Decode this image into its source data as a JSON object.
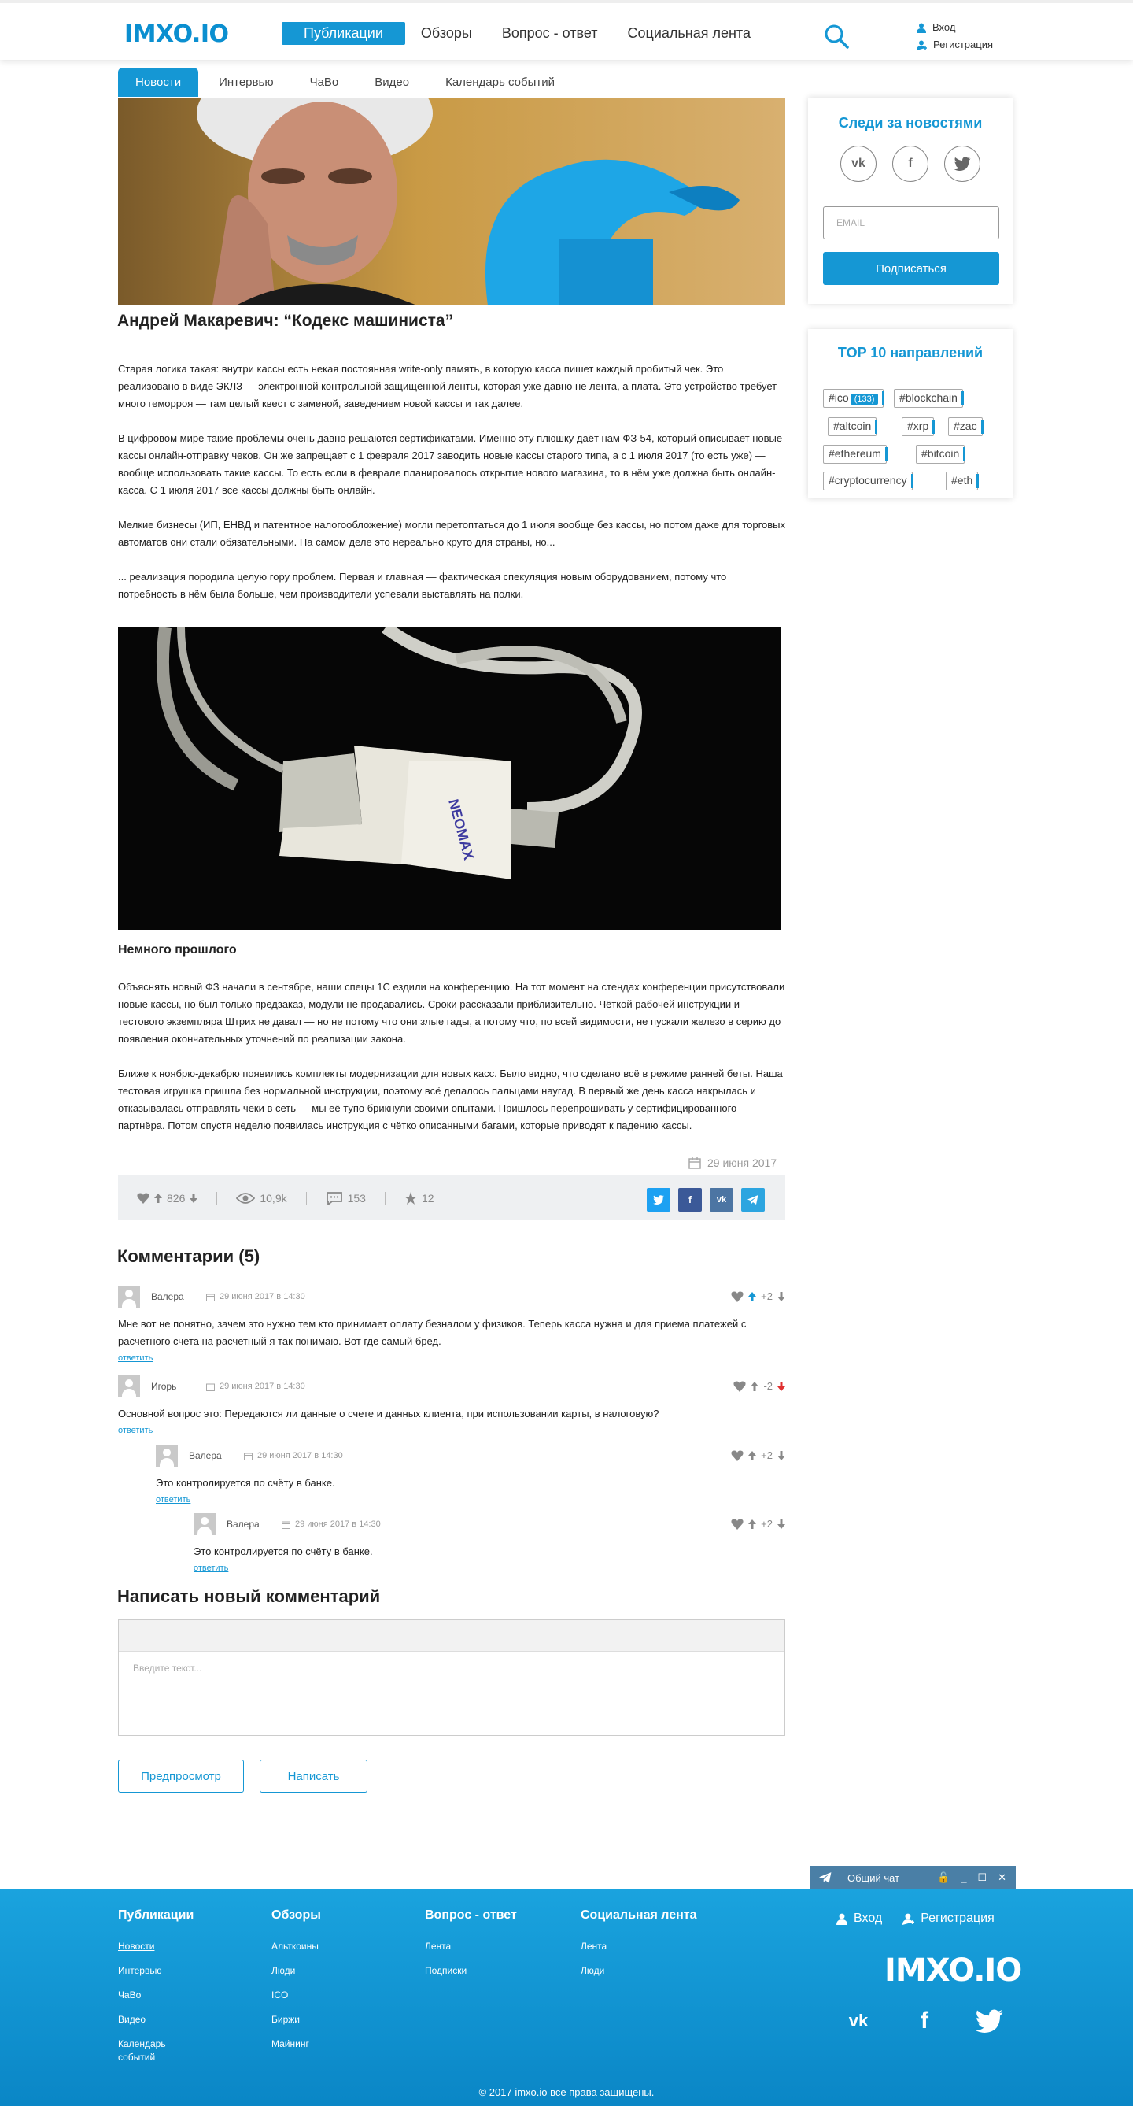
{
  "header": {
    "logo": "IMXO.IO",
    "nav": [
      "Публикации",
      "Обзоры",
      "Вопрос - ответ",
      "Социальная лента"
    ],
    "login": "Вход",
    "register": "Регистрация"
  },
  "subnav": [
    "Новости",
    "Интервью",
    "ЧаВо",
    "Видео",
    "Календарь событий"
  ],
  "article": {
    "title": "Андрей Макаревич: “Кодекс машиниста”",
    "paragraphs": [
      "Старая логика такая: внутри кассы есть некая постоянная write-only память, в которую касса пишет каждый пробитый чек. Это реализовано в виде ЭКЛЗ — электронной контрольной защищённой ленты, которая уже давно не лента, а плата. Это устройство требует много геморроя — там целый квест с заменой, заведением новой кассы и так далее.",
      "В цифровом мире такие проблемы очень давно решаются сертификатами. Именно эту плюшку даёт нам ФЗ-54, который описывает новые кассы онлайн-отправку чеков. Он же запрещает с 1 февраля 2017 заводить новые кассы старого типа, а с 1 июля 2017 (то есть уже) — вообще использовать такие кассы. То есть если в феврале планировалось открытие нового магазина, то в нём уже должна быть онлайн-касса. С 1 июля 2017 все кассы должны быть онлайн.",
      "Мелкие бизнесы (ИП, ЕНВД и патентное налогообложение) могли перетоптаться до 1 июля вообще без кассы, но потом даже для торговых автоматов они стали обязательными. На самом деле это нереально круто для страны, но...",
      "... реализация породила целую гору проблем. Первая и главная — фактическая спекуляция новым оборудованием, потому что потребность в нём была больше, чем производители успевали выставлять на полки."
    ],
    "photo_label": "NEOMAX",
    "subheading": "Немного прошлого",
    "paragraphs2": [
      "Объяснять новый ФЗ начали в сентябре, наши спецы 1С ездили на конференцию. На тот момент на стендах конференции присутствовали новые кассы, но был только предзаказ, модули не продавались. Сроки рассказали приблизительно. Чёткой рабочей инструкции и тестового экземпляра Штрих не давал — но не потому что они злые гады, а потому что, по всей видимости, не пускали железо в серию до появления окончательных уточнений по реализации закона.",
      "Ближе к ноябрю-декабрю появились комплекты модернизации для новых касс. Было видно, что сделано всё в режиме ранней беты. Наша тестовая игрушка пришла без нормальной инструкции, поэтому всё делалось пальцами наугад. В первый же день касса накрылась и отказывалась отправлять чеки в сеть — мы её тупо брикнули своими опытами. Пришлось перепрошивать у сертифицированного партнёра. Потом спустя неделю появилась инструкция с чётко описанными багами, которые приводят к падению кассы."
    ],
    "date": "29 июня 2017",
    "stats": {
      "likes": "826",
      "views": "10,9k",
      "comments": "153",
      "favorites": "12"
    }
  },
  "comments": {
    "title": "Комментарии (5)",
    "reply_label": "ответить",
    "items": [
      {
        "name": "Валера",
        "date": "29 июня 2017 в 14:30",
        "score": "+2",
        "text": "Мне вот не понятно, зачем это нужно тем кто принимает оплату безналом у физиков. Теперь касса нужна и для приема платежей с расчетного счета на расчетный я так понимаю. Вот где самый бред."
      },
      {
        "name": "Игорь",
        "date": "29 июня 2017 в 14:30",
        "score": "-2",
        "text": "Основной вопрос это: Передаются ли данные о счете и данных клиента, при использовании карты, в налоговую?"
      },
      {
        "name": "Валера",
        "date": "29 июня 2017 в 14:30",
        "score": "+2",
        "text": "Это контролируется по счёту в банке."
      },
      {
        "name": "Валера",
        "date": "29 июня 2017 в 14:30",
        "score": "+2",
        "text": "Это контролируется по счёту в банке."
      }
    ]
  },
  "new_comment": {
    "title": "Написать новый комментарий",
    "placeholder": "Введите текст...",
    "preview_button": "Предпросмотр",
    "submit_button": "Написать"
  },
  "sidebar": {
    "follow_title": "Следи за новостями",
    "email_placeholder": "EMAIL",
    "subscribe_button": "Подписаться",
    "top_title": "TOP 10 направлений",
    "tags": [
      "#ico",
      "#blockchain",
      "#altcoin",
      "#xrp",
      "#zac",
      "#ethereum",
      "#bitcoin",
      "#cryptocurrency",
      "#eth"
    ],
    "tag_count": "(133)"
  },
  "chat": {
    "label": "Общий чат"
  },
  "footer": {
    "columns": [
      {
        "title": "Публикации",
        "links": [
          "Новости",
          "Интервью",
          "ЧаВо",
          "Видео",
          "Календарь событий"
        ]
      },
      {
        "title": "Обзоры",
        "links": [
          "Альткоины",
          "Люди",
          "ICO",
          "Биржи",
          "Майнинг"
        ]
      },
      {
        "title": "Вопрос - ответ",
        "links": [
          "Лента",
          "Подписки"
        ]
      },
      {
        "title": "Социальная лента",
        "links": [
          "Лента",
          "Люди"
        ]
      }
    ],
    "login": "Вход",
    "register": "Регистрация",
    "logo": "IMXO.IO",
    "copyright": "© 2017 imxo.io все права защищены."
  },
  "colors": {
    "accent": "#1597d4",
    "footer": "#0f96d6"
  }
}
